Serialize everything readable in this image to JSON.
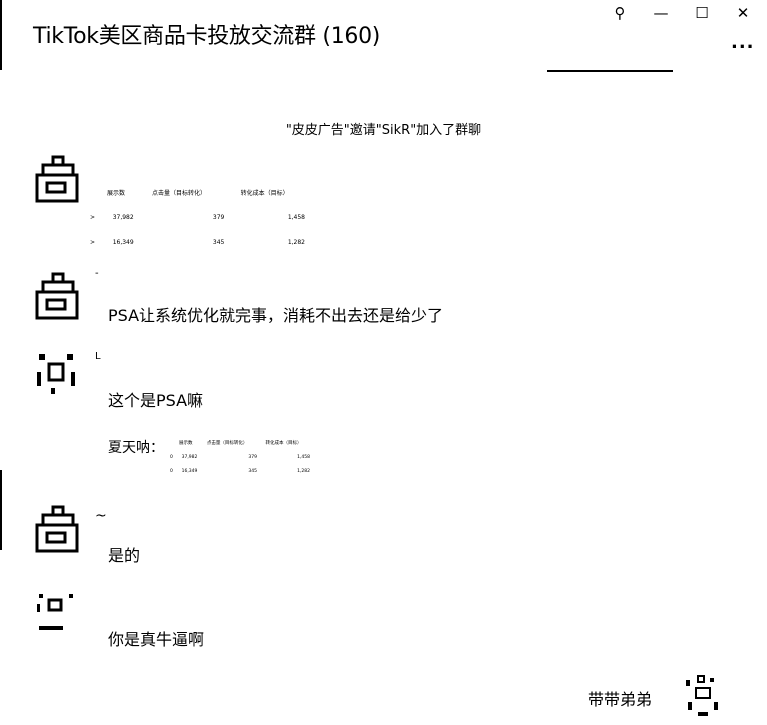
{
  "window": {
    "title": "TikTok美区商品卡投放交流群 (160)",
    "controls": {
      "pin": "⚲",
      "minimize": "—",
      "maximize": "☐",
      "close": "✕"
    },
    "more": "..."
  },
  "system_message": "\"皮皮广告\"邀请\"SikR\"加入了群聊",
  "messages": [
    {
      "id": "m1",
      "name": "",
      "image_table": {
        "headers": [
          "展示数",
          "点击量（目标转化）",
          "转化成本（目标）"
        ],
        "rows": [
          {
            "marker": ">",
            "values": [
              "37,982",
              "379",
              "1,458"
            ]
          },
          {
            "marker": ">",
            "values": [
              "16,349",
              "345",
              "1,282"
            ]
          }
        ]
      }
    },
    {
      "id": "m2",
      "name": "-",
      "text": "PSA让系统优化就完事，消耗不出去还是给少了"
    },
    {
      "id": "m3",
      "name": "L",
      "text": "这个是PSA嘛",
      "quote": {
        "author": "夏天呐：",
        "image_table": {
          "headers": [
            "展示数",
            "点击量（目标转化）",
            "转化成本（目标）"
          ],
          "rows": [
            {
              "marker": "0",
              "values": [
                "37,982",
                "379",
                "1,458"
              ]
            },
            {
              "marker": "0",
              "values": [
                "16,349",
                "345",
                "1,282"
              ]
            }
          ]
        }
      }
    },
    {
      "id": "m4",
      "name": "~",
      "text": "是的"
    },
    {
      "id": "m5",
      "name": "",
      "text": "你是真牛逼啊"
    }
  ],
  "bottom": {
    "name": "带带弟弟"
  }
}
